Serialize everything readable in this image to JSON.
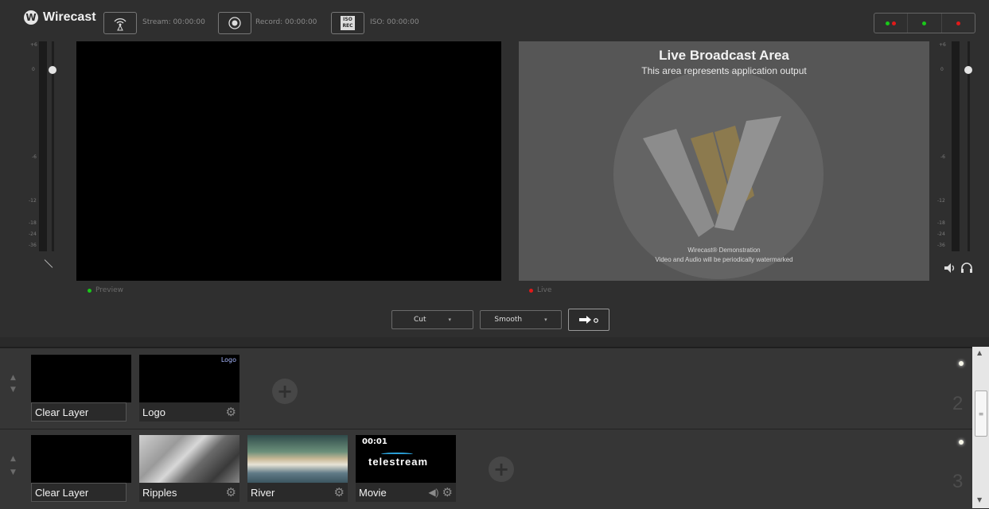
{
  "app": {
    "name": "Wirecast"
  },
  "toolbar": {
    "stream_label": "Stream: 00:00:00",
    "record_label": "Record: 00:00:00",
    "iso_label": "ISO: 00:00:00",
    "iso_icon_text": "ISO\nREC"
  },
  "status_indicators": {
    "colors": [
      "#19c819",
      "#e11919"
    ]
  },
  "audio_meter_left": {
    "scale": [
      "+6",
      "0",
      "-6",
      "-12",
      "-18",
      "-24",
      "-36"
    ]
  },
  "audio_meter_right": {
    "scale": [
      "+6",
      "0",
      "-6",
      "-12",
      "-18",
      "-24",
      "-36"
    ]
  },
  "preview": {
    "label": "Preview",
    "dot_color": "#19c819"
  },
  "live": {
    "label": "Live",
    "dot_color": "#e11919",
    "title": "Live Broadcast Area",
    "subtitle": "This area represents application output",
    "watermark_line1": "Wirecast® Demonstration",
    "watermark_line2": "Video and Audio will be periodically watermarked"
  },
  "transitions": {
    "cut_label": "Cut",
    "smooth_label": "Smooth"
  },
  "layers": [
    {
      "number": "2",
      "shots": [
        {
          "label": "Clear Layer",
          "type": "clear"
        },
        {
          "label": "Logo",
          "type": "logo",
          "overlay": "Logo"
        }
      ]
    },
    {
      "number": "3",
      "shots": [
        {
          "label": "Clear Layer",
          "type": "clear"
        },
        {
          "label": "Ripples",
          "type": "ripples"
        },
        {
          "label": "River",
          "type": "river"
        },
        {
          "label": "Movie",
          "type": "movie",
          "timecode": "00:01",
          "brand": "telestream"
        }
      ]
    }
  ]
}
